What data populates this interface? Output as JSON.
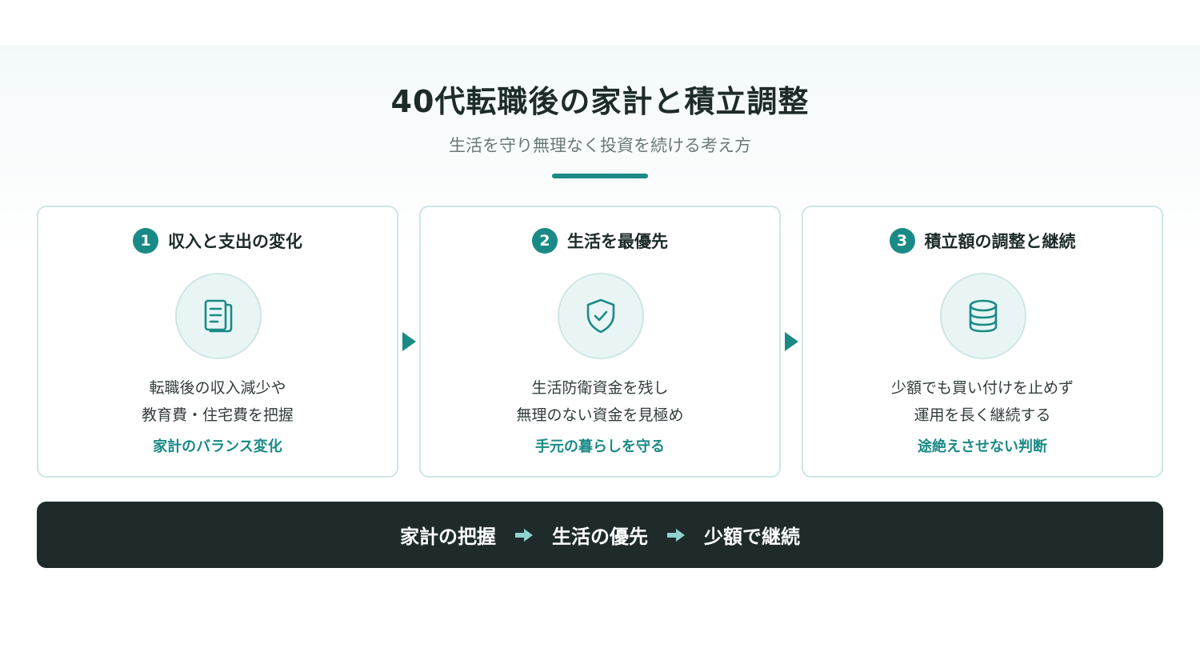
{
  "header": {
    "title": "40代転職後の家計と積立調整",
    "subtitle": "生活を守り無理なく投資を続ける考え方"
  },
  "steps": [
    {
      "number": "1",
      "title": "収入と支出の変化",
      "icon": "document-icon",
      "line1": "転職後の収入減少や",
      "line2": "教育費・住宅費を把握",
      "tag": "家計のバランス変化"
    },
    {
      "number": "2",
      "title": "生活を最優先",
      "icon": "shield-check-icon",
      "line1": "生活防衛資金を残し",
      "line2": "無理のない資金を見極め",
      "tag": "手元の暮らしを守る"
    },
    {
      "number": "3",
      "title": "積立額の調整と継続",
      "icon": "database-icon",
      "line1": "少額でも買い付けを止めず",
      "line2": "運用を長く継続する",
      "tag": "途絶えさせない判断"
    }
  ],
  "flow": {
    "items": [
      "家計の把握",
      "生活の優先",
      "少額で継続"
    ],
    "arrow_icon": "right-arrow-icon"
  },
  "colors": {
    "accent": "#1a8a86",
    "dark": "#1f2b2b",
    "card_border": "#cde6e6",
    "icon_bg": "#e8f5f4",
    "flow_arrow": "#8fd3cf"
  }
}
